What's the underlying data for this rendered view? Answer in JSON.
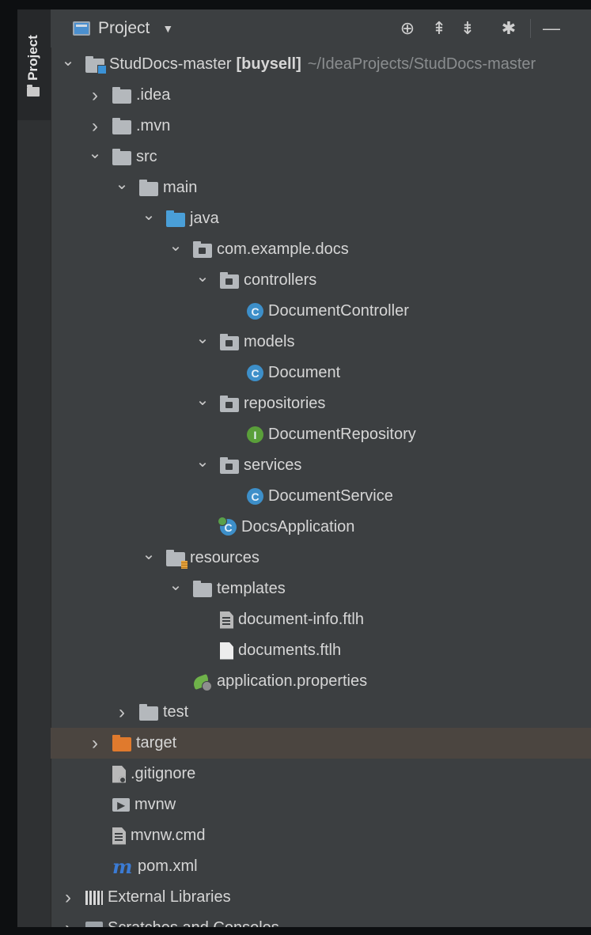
{
  "side_tab": {
    "label": "Project"
  },
  "toolbar": {
    "title": "Project",
    "dropdown_icon": "caret-down-icon",
    "buttons": [
      {
        "name": "locate-icon",
        "glyph": "⊕"
      },
      {
        "name": "expand-all-icon",
        "glyph": "⇞"
      },
      {
        "name": "collapse-all-icon",
        "glyph": "⇟"
      },
      {
        "name": "gear-icon",
        "glyph": "✱"
      },
      {
        "name": "minimize-icon",
        "glyph": "—"
      }
    ]
  },
  "tree": [
    {
      "depth": 0,
      "expanded": true,
      "icon": "module-folder",
      "label": "StudDocs-master",
      "bold": "[buysell]",
      "hint": "~/IdeaProjects/StudDocs-master"
    },
    {
      "depth": 1,
      "expanded": false,
      "icon": "folder",
      "label": ".idea"
    },
    {
      "depth": 1,
      "expanded": false,
      "icon": "folder",
      "label": ".mvn"
    },
    {
      "depth": 1,
      "expanded": true,
      "icon": "folder",
      "label": "src"
    },
    {
      "depth": 2,
      "expanded": true,
      "icon": "folder",
      "label": "main"
    },
    {
      "depth": 3,
      "expanded": true,
      "icon": "folder-blue",
      "label": "java"
    },
    {
      "depth": 4,
      "expanded": true,
      "icon": "package",
      "label": "com.example.docs"
    },
    {
      "depth": 5,
      "expanded": true,
      "icon": "package",
      "label": "controllers"
    },
    {
      "depth": 6,
      "expanded": null,
      "icon": "class",
      "label": "DocumentController"
    },
    {
      "depth": 5,
      "expanded": true,
      "icon": "package",
      "label": "models"
    },
    {
      "depth": 6,
      "expanded": null,
      "icon": "class",
      "label": "Document"
    },
    {
      "depth": 5,
      "expanded": true,
      "icon": "package",
      "label": "repositories"
    },
    {
      "depth": 6,
      "expanded": null,
      "icon": "interface",
      "label": "DocumentRepository"
    },
    {
      "depth": 5,
      "expanded": true,
      "icon": "package",
      "label": "services"
    },
    {
      "depth": 6,
      "expanded": null,
      "icon": "class",
      "label": "DocumentService"
    },
    {
      "depth": 5,
      "expanded": null,
      "icon": "spring-app",
      "label": "DocsApplication"
    },
    {
      "depth": 3,
      "expanded": true,
      "icon": "resources-folder",
      "label": "resources"
    },
    {
      "depth": 4,
      "expanded": true,
      "icon": "folder",
      "label": "templates"
    },
    {
      "depth": 5,
      "expanded": null,
      "icon": "template-file",
      "label": "document-info.ftlh"
    },
    {
      "depth": 5,
      "expanded": null,
      "icon": "file",
      "label": "documents.ftlh"
    },
    {
      "depth": 4,
      "expanded": null,
      "icon": "properties-file",
      "label": "application.properties"
    },
    {
      "depth": 2,
      "expanded": false,
      "icon": "folder",
      "label": "test"
    },
    {
      "depth": 1,
      "expanded": false,
      "icon": "folder-orange",
      "label": "target",
      "selected": true
    },
    {
      "depth": 1,
      "expanded": null,
      "icon": "gitignore-file",
      "label": ".gitignore"
    },
    {
      "depth": 1,
      "expanded": null,
      "icon": "exec-file",
      "label": "mvnw"
    },
    {
      "depth": 1,
      "expanded": null,
      "icon": "template-file",
      "label": "mvnw.cmd"
    },
    {
      "depth": 1,
      "expanded": null,
      "icon": "maven-file",
      "label": "pom.xml"
    },
    {
      "depth": 0,
      "expanded": false,
      "icon": "libraries",
      "label": "External Libraries"
    },
    {
      "depth": 0,
      "expanded": false,
      "icon": "scratches",
      "label": "Scratches and Consoles"
    }
  ]
}
